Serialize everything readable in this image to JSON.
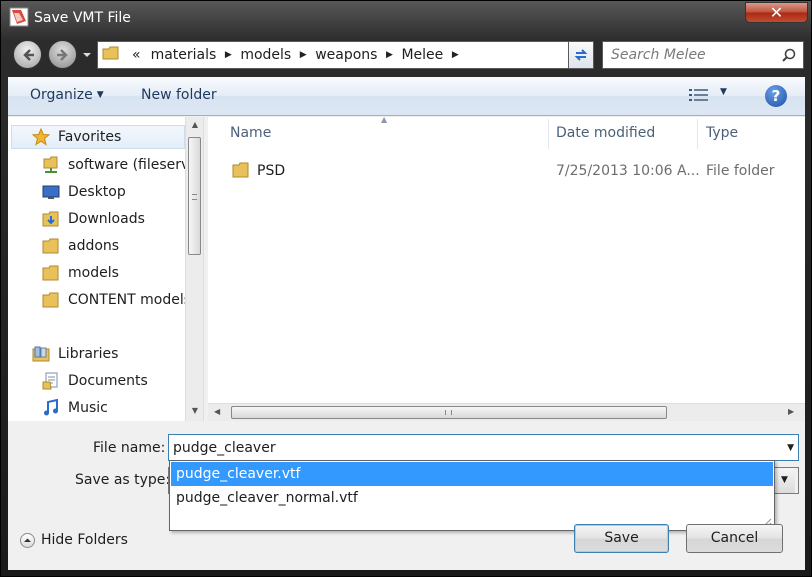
{
  "window": {
    "title": "Save VMT File",
    "close_label": "✕"
  },
  "address": {
    "overflow_marker": "«",
    "breadcrumbs": [
      "materials",
      "models",
      "weapons",
      "Melee"
    ]
  },
  "search": {
    "placeholder": "Search Melee"
  },
  "toolbar": {
    "organize_label": "Organize",
    "new_folder_label": "New folder",
    "help_label": "?"
  },
  "navpane": {
    "favorites_label": "Favorites",
    "favorites": [
      "software (fileserver)",
      "Desktop",
      "Downloads",
      "addons",
      "models",
      "CONTENT models"
    ],
    "libraries_label": "Libraries",
    "libraries": [
      "Documents",
      "Music"
    ]
  },
  "filelist": {
    "columns": {
      "name": "Name",
      "date": "Date modified",
      "type": "Type"
    },
    "rows": [
      {
        "name": "PSD",
        "date": "7/25/2013 10:06 A...",
        "type": "File folder"
      }
    ]
  },
  "form": {
    "file_name_label": "File name:",
    "file_name_value": "pudge_cleaver",
    "save_as_type_label": "Save as type:",
    "autocomplete": [
      "pudge_cleaver.vtf",
      "pudge_cleaver_normal.vtf"
    ]
  },
  "footer": {
    "hide_folders_label": "Hide Folders",
    "save_label": "Save",
    "cancel_label": "Cancel"
  },
  "colors": {
    "selection": "#3399ff",
    "accent": "#3c7fb1"
  },
  "icons": {
    "app": "vmt-app-icon",
    "folder": "folder-icon",
    "star": "star-icon",
    "desktop": "desktop-icon",
    "downloads": "downloads-folder-icon",
    "libraries": "libraries-icon",
    "documents": "documents-icon",
    "music": "music-icon"
  }
}
